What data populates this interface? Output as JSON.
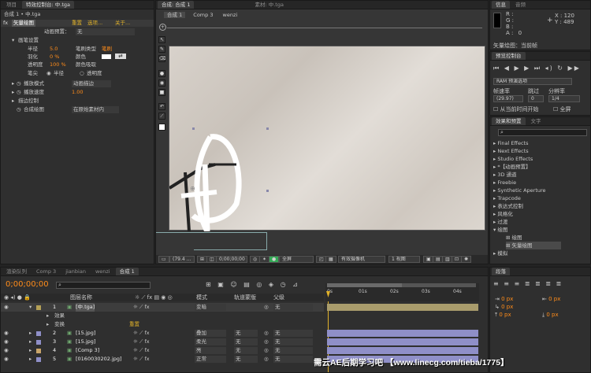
{
  "top_tabs": {
    "project": "项目",
    "effect_controls": "特效控制台: 中.tga",
    "composition": "合成: 合成 1",
    "footage": "素材: 中.tga",
    "info": "信息",
    "audio": "音频"
  },
  "effect_controls": {
    "breadcrumb": "合成 1 • 中.tga",
    "effect_name": "矢量绘图",
    "reset": "重置",
    "options": "选项...",
    "about": "关于...",
    "preset_label": "动画预置：",
    "preset_value": "无",
    "brush_settings": "画笔设置",
    "radius_label": "半径",
    "radius_value": "5.0",
    "brush_type_label": "笔刷类型",
    "brush_type_value": "笔刷",
    "feather_label": "羽化",
    "feather_value": "0 %",
    "color_label": "颜色",
    "opacity_label": "透明度",
    "opacity_value": "100 %",
    "color_picker_label": "颜色吸取",
    "pen_label": "笔尖",
    "radius_option": "半径",
    "opacity_option": "透明度",
    "playback_mode_label": "播放模式",
    "playback_mode_value": "动画描边",
    "playback_speed_label": "播放速度",
    "playback_speed_value": "1.00",
    "shape_control_label": "描边控制",
    "composite_label": "合成绘图",
    "composite_value": "在原始素材内"
  },
  "comp_panel": {
    "tab_comp1": "合成 1",
    "crumb_comp3": "Comp 3",
    "crumb_wenzi": "wenzi",
    "zoom": "(79.4 ...",
    "timecode": "0;00;00;00",
    "resolution": "全屏",
    "camera": "有效摄像机",
    "views": "1 视图"
  },
  "info_panel": {
    "r": "R :",
    "g": "G :",
    "b": "B :",
    "a_label": "A :",
    "a_value": "0",
    "x": "X : 120",
    "y": "Y : 489",
    "status": "矢量绘图：当前帧"
  },
  "preview_panel": {
    "title": "预览控制台",
    "ram_preview": "RAM 预演选项",
    "framerate_label": "帧速率",
    "skip_label": "跳过",
    "resolution_label": "分辨率",
    "framerate_value": "(29.97)",
    "skip_value": "0",
    "resolution_value": "1/4",
    "from_current": "从当前时间开始",
    "fullscreen": "全屏"
  },
  "effects_panel": {
    "title": "效果和预置",
    "tab_text": "文字",
    "search_placeholder": "",
    "items": [
      "Final Effects",
      "Next Effects",
      "Studio Effects",
      "*【动画预置】",
      "3D 通道",
      "Freebie",
      "Synthetic Aperture",
      "Trapcode",
      "表达式控制",
      "风格化",
      "过渡",
      "绘图",
      "绘图",
      "矢量绘图",
      "模拟"
    ]
  },
  "timeline": {
    "tabs": [
      "渲染队列",
      "Comp 3",
      "jianbian",
      "wenzi",
      "合成 1"
    ],
    "timecode": "0;00;00;00",
    "search_placeholder": "",
    "col_layer_name": "图层名称",
    "col_mode": "模式",
    "col_trkmat": "轨道蒙版",
    "col_parent": "父级",
    "ruler": [
      "0s",
      "01s",
      "02s",
      "03s",
      "04s"
    ],
    "layers": [
      {
        "num": "1",
        "name": "[中.tga]",
        "mode": "",
        "trk": "",
        "parent": "无",
        "color": "#b4a056"
      },
      {
        "num": "2",
        "name": "[15.jpg]",
        "mode": "叠加",
        "trk": "无",
        "parent": "无",
        "color": "#8f8fc8"
      },
      {
        "num": "3",
        "name": "[15.jpg]",
        "mode": "柔光",
        "trk": "无",
        "parent": "无",
        "color": "#8f8fc8"
      },
      {
        "num": "4",
        "name": "[Comp 3]",
        "mode": "亮",
        "trk": "无",
        "parent": "无",
        "color": "#c9a56a"
      },
      {
        "num": "5",
        "name": "[0160030202.jpg]",
        "mode": "正常",
        "trk": "无",
        "parent": "无",
        "color": "#8f8fc8"
      }
    ],
    "effects_label": "效果",
    "transform_label": "变换",
    "transform_reset": "重置",
    "mode_value_1": "变暗",
    "parent_value_1": "无"
  },
  "paragraph_panel": {
    "title": "段落",
    "px1": "0 px",
    "px2": "0 px",
    "px3": "0 px",
    "px4": "0 px",
    "px5": "0 px"
  },
  "watermark": "需云AE后期学习吧 【www.linecg.com/tieba/1775】",
  "colors": {
    "accent": "#e1b22a",
    "timecode": "#ff8c1a",
    "bar": "#8f8fc8"
  }
}
